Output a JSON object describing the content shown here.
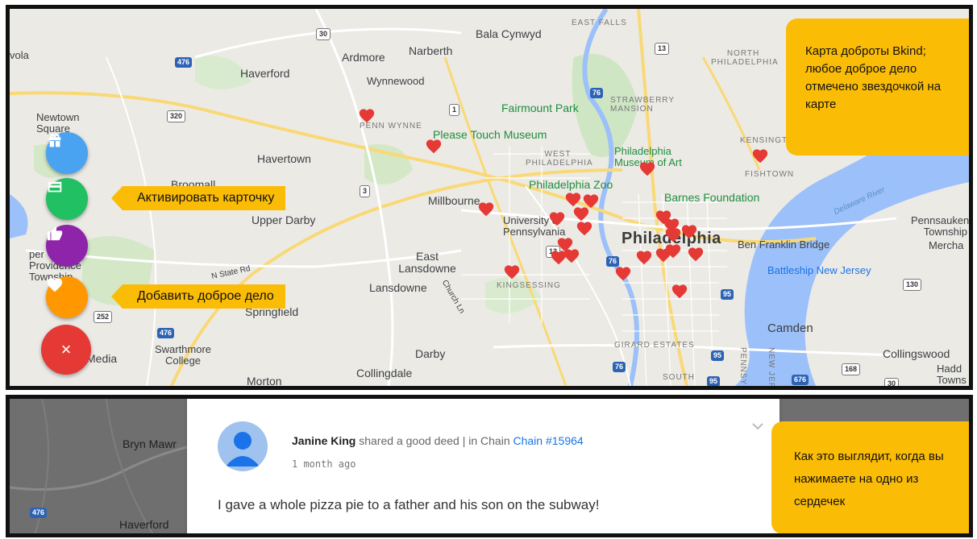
{
  "map_top": {
    "annotation": "Карта доброты Bkind; любое доброе дело отмечено звездочкой на карте",
    "places": {
      "bala_cynwyd": "Bala Cynwyd",
      "east_falls": "EAST FALLS",
      "ardmore": "Ardmore",
      "narberth": "Narberth",
      "north_philadelphia": "NORTH PHILADELPHIA",
      "haverford": "Haverford",
      "wynnewood": "Wynnewood",
      "strawberry_mansion": "STRAWBERRY MANSION",
      "fairmount_park": "Fairmount Park",
      "newtown_square": "Newtown Square",
      "penn_wynne": "PENN WYNNE",
      "please_touch_museum": "Please Touch Museum",
      "kensington": "KENSINGT",
      "havertown": "Havertown",
      "west_philadelphia": "WEST PHILADELPHIA",
      "philadelphia_museum_of_art": "Philadelphia Museum of Art",
      "fishtown": "FISHTOWN",
      "broomall": "Broomall",
      "philadelphia_zoo": "Philadelphia Zoo",
      "barnes_foundation": "Barnes Foundation",
      "delaware_river": "Delaware River",
      "millbourne": "Millbourne",
      "upper_darby": "Upper Darby",
      "university_of_pennsylvania": "University of Pennsylvania",
      "philadelphia": "Philadelphia",
      "ben_franklin_bridge": "Ben Franklin Bridge",
      "pennsauken_township": "Pennsauken Township",
      "merchantville": "Mercha",
      "upper_providence": "per Providence Township",
      "n_state_rd": "N State Rd",
      "east_lansdowne": "East Lansdowne",
      "battleship_new_jersey": "Battleship New Jersey",
      "lansdowne": "Lansdowne",
      "kingsessing": "KINGSESSING",
      "church_ln": "Church Ln",
      "springfield": "Springfield",
      "camden": "Camden",
      "swarthmore_college": "Swarthmore College",
      "media": "Media",
      "darby": "Darby",
      "girard_estates": "GIRARD ESTATES",
      "collingswood": "Collingswood",
      "morton": "Morton",
      "collingdale": "Collingdale",
      "south": "SOUTH",
      "haddon": "Hadd Towns",
      "penns_landing": "PENNSYL",
      "new_jersey": "NEW JER",
      "vola": "vola"
    },
    "shields": {
      "s30": "30",
      "s476a": "476",
      "s13": "13",
      "s76": "76",
      "s1": "1",
      "s320": "320",
      "s3": "3",
      "s252": "252",
      "s476b": "476",
      "s95a": "95",
      "s76b": "76",
      "s95b": "95",
      "s130": "130",
      "s168": "168",
      "s676": "676",
      "s95c": "95",
      "s76c": "76",
      "s30b": "30",
      "s13b": "13"
    },
    "fab_menu": {
      "gift": {
        "icon": "gift-icon",
        "color": "#4aa3f0"
      },
      "card": {
        "icon": "card-icon",
        "color": "#21c063",
        "tooltip": "Активировать карточку"
      },
      "like": {
        "icon": "thumbs-up-icon",
        "color": "#8e24aa"
      },
      "heart": {
        "icon": "heart-icon",
        "color": "#ff9800",
        "tooltip": "Добавить доброе дело"
      },
      "close": {
        "icon": "close-icon",
        "color": "#e53935",
        "symbol": "×"
      }
    },
    "heart_color": "#e53935"
  },
  "bottom": {
    "map_labels": {
      "bryn_mawr": "Bryn Mawr",
      "haverford": "Haverford",
      "shield": "476"
    },
    "post": {
      "author": "Janine King",
      "action": "shared a good deed",
      "separator": "|",
      "in_label": "in Chain",
      "chain": "Chain #15964",
      "time": "1 month ago",
      "text": "I gave a whole pizza pie to a father and his son on the subway!"
    },
    "annotation": "Как это выглядит, когда вы нажимаете на одно из сердечек"
  },
  "colors": {
    "accent": "#fbbc05",
    "link": "#1a73e8"
  }
}
